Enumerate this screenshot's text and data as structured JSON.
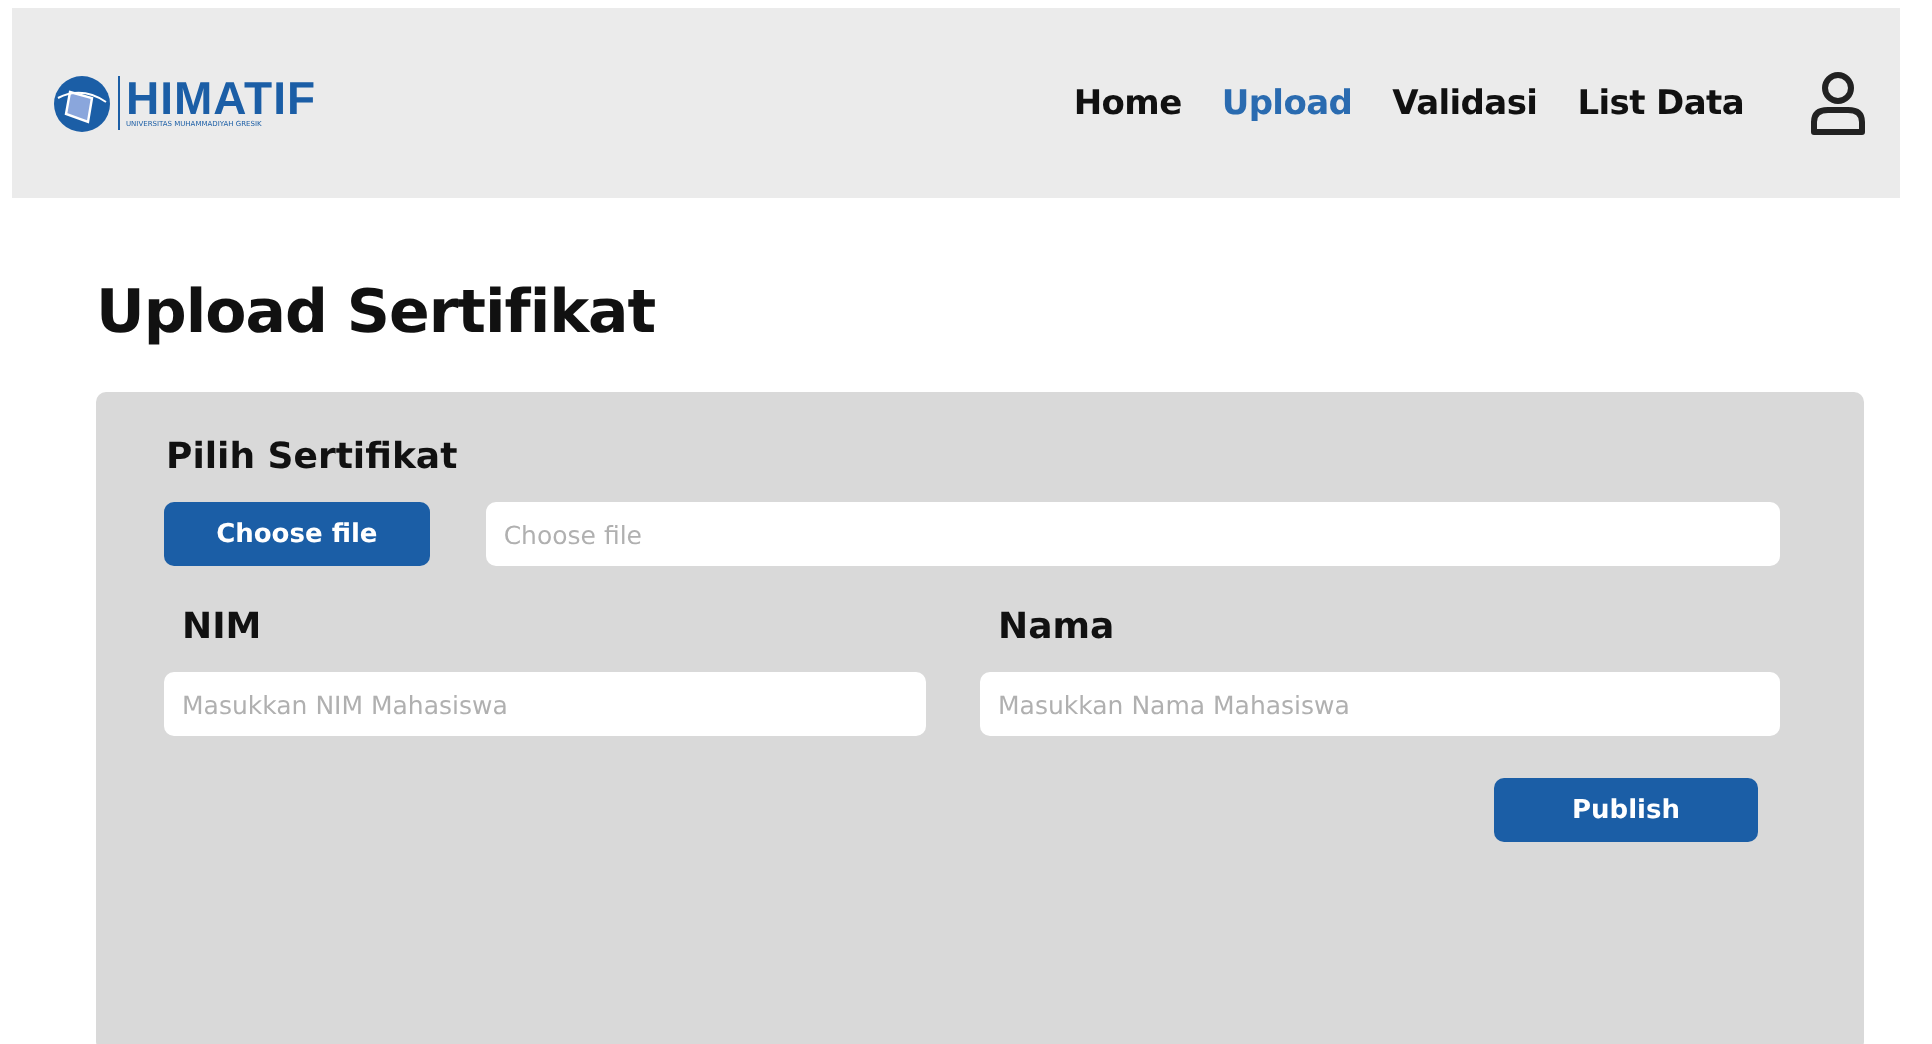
{
  "header": {
    "logo": {
      "name": "HIMATIF",
      "subtitle": "UNIVERSITAS MUHAMMADIYAH GRESIK"
    },
    "nav": [
      {
        "label": "Home",
        "selected": false
      },
      {
        "label": "Upload",
        "selected": true
      },
      {
        "label": "Validasi",
        "selected": false
      },
      {
        "label": "List Data",
        "selected": false
      }
    ]
  },
  "title": "Upload Sertifikat",
  "form": {
    "file_label": "Pilih Sertifikat",
    "file_button": "Choose file",
    "file_placeholder": "Choose file",
    "fields": [
      {
        "label": "NIM",
        "placeholder": "Masukkan NIM Mahasiswa"
      },
      {
        "label": "Nama",
        "placeholder": "Masukkan Nama Mahasiswa"
      }
    ],
    "submit": "Publish"
  }
}
